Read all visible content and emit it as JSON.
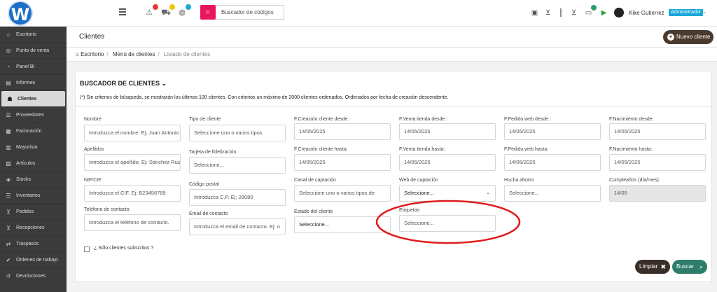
{
  "topbar": {
    "logo": "W",
    "search_placeholder": "Buscador de códigos",
    "user_name": "Kike Gutierrez",
    "user_role": "Administrador",
    "colors": {
      "search_button": "#e8175d",
      "role_badge": "#1ba8d8",
      "logo": "#1e6fc8"
    },
    "icons": [
      "menu-icon",
      "warning-icon",
      "truck-icon",
      "globe-icon",
      "search-icon",
      "clipboard-icon",
      "cart-icon",
      "barcode-icon",
      "cart-list-icon",
      "chat-icon",
      "barcode-scan-icon",
      "play-circle-icon"
    ]
  },
  "sidebar": {
    "items": [
      {
        "label": "Escritorio",
        "icon": "home-icon"
      },
      {
        "label": "Punto de venta",
        "icon": "pos-icon"
      },
      {
        "label": "Panel BI",
        "icon": "pie-chart-icon"
      },
      {
        "label": "Informes",
        "icon": "reports-icon"
      },
      {
        "label": "Clientes",
        "icon": "users-icon",
        "active": true
      },
      {
        "label": "Proveedores",
        "icon": "supplier-icon"
      },
      {
        "label": "Facturación",
        "icon": "invoice-icon"
      },
      {
        "label": "Mayorista",
        "icon": "wholesale-icon"
      },
      {
        "label": "Artículos",
        "icon": "articles-icon"
      },
      {
        "label": "Stocks",
        "icon": "tag-icon"
      },
      {
        "label": "Inventarios",
        "icon": "inventory-icon"
      },
      {
        "label": "Pedidos",
        "icon": "cart-icon"
      },
      {
        "label": "Recepciones",
        "icon": "reception-icon"
      },
      {
        "label": "Traspasos",
        "icon": "transfer-icon"
      },
      {
        "label": "Órdenes de trabajo",
        "icon": "check-icon"
      },
      {
        "label": "Devoluciones",
        "icon": "return-icon"
      }
    ]
  },
  "header": {
    "title": "Clientes",
    "new_button": "Nuevo cliente",
    "breadcrumb": [
      "Escritorio",
      "Menú de clientes",
      "Listado de clientes"
    ]
  },
  "search": {
    "title": "BUSCADOR DE CLIENTES",
    "note": "(*) Sin criterios de búsqueda, se mostrarán los últimos 100 clientes. Con criterios un máximo de 2000 clientes ordenados. Ordenados por fecha de creación descendente.",
    "fields": {
      "nombre": {
        "label": "Nombre",
        "placeholder": "Introduzca el nombre. Ej: Juan Antonio"
      },
      "tipo": {
        "label": "Tipo de cliente",
        "placeholder": "Seleccione uno o varios tipos"
      },
      "fcreacion_desde": {
        "label": "F.Creación cliente desde :",
        "value": "14/05/2025"
      },
      "fventa_desde": {
        "label": "F.Venta tienda desde :",
        "value": "14/05/2025"
      },
      "fpedido_desde": {
        "label": "F.Pedido web desde :",
        "value": "14/05/2025"
      },
      "fnac_desde": {
        "label": "F.Nacimiento desde:",
        "value": "14/05/2025"
      },
      "apellidos": {
        "label": "Apellidos",
        "placeholder": "Introduzca el apellido. Ej: Sánchez Ruiz"
      },
      "tarjeta": {
        "label": "Tarjeta de fidelización",
        "placeholder": "Seleccione..."
      },
      "fcreacion_hasta": {
        "label": "F.Creación cliente hasta:",
        "value": "14/05/2025"
      },
      "fventa_hasta": {
        "label": "F.Venta tienda hasta:",
        "value": "14/05/2025"
      },
      "fpedido_hasta": {
        "label": "F.Pedido web hasta:",
        "value": "14/05/2025"
      },
      "fnac_hasta": {
        "label": "F.Nacimiento hasta:",
        "value": "14/05/2025"
      },
      "nif": {
        "label": "NIF/CIF",
        "placeholder": "Introduzca el CIF. Ej: B23456789"
      },
      "cp": {
        "label": "Código postal",
        "placeholder": "Introduzca C.P. Ej: 28080"
      },
      "canal": {
        "label": "Canal de captación",
        "placeholder": "Seleccione uno o varios tipos de"
      },
      "web": {
        "label": "Web de captación",
        "value": "Seleccione..."
      },
      "hucha": {
        "label": "Hucha ahorro",
        "placeholder": "Seleccione..."
      },
      "cumple": {
        "label": "Cumpleaños (día/mes):",
        "value": "14/05"
      },
      "telefono": {
        "label": "Teléfono de contacto",
        "placeholder": "Introduzca el teléfono de contacto."
      },
      "email": {
        "label": "Email de contacto",
        "placeholder": "Introduzca el email de contacto. Ej: n"
      },
      "estado": {
        "label": "Estado del cliente",
        "value": "Seleccione..."
      },
      "etiquetas": {
        "label": "Etiquetas",
        "placeholder": "Seleccione..."
      }
    },
    "subscribed_label": "¿ Sólo clientes subscritos ?",
    "clear_button": "Limpiar",
    "search_button": "Buscar",
    "colors": {
      "clear": "#3a2f28",
      "search": "#2e7d6b",
      "highlight": "#e01b1b"
    }
  }
}
